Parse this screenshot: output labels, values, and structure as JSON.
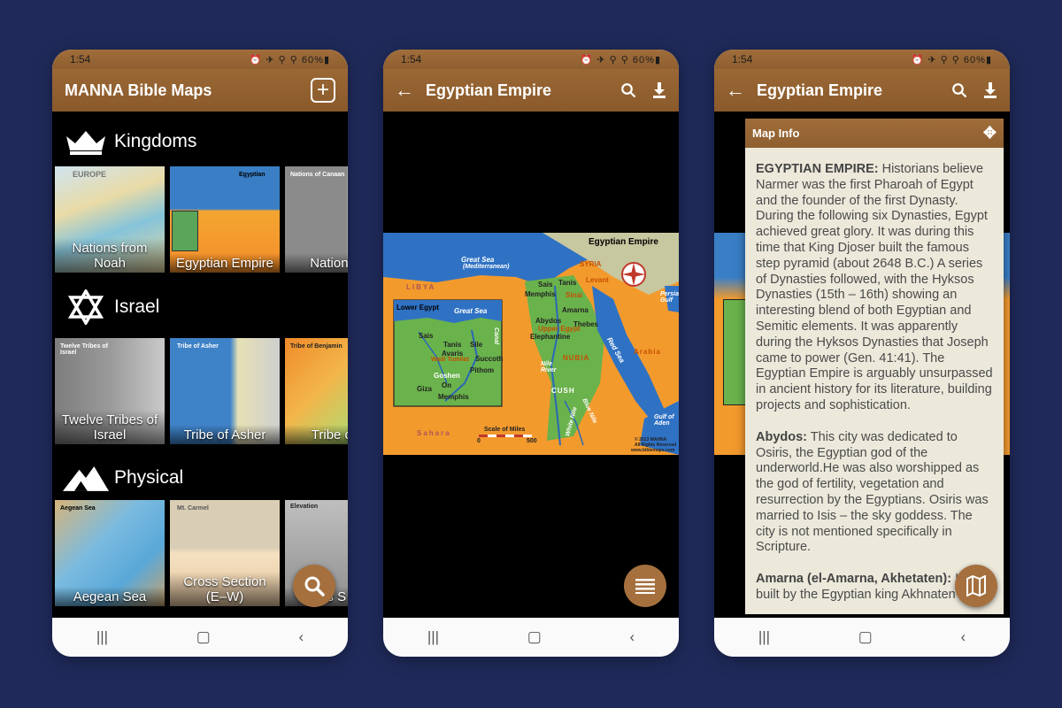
{
  "status": {
    "time": "1:54",
    "battery": "60%"
  },
  "phone1": {
    "app_title": "MANNA Bible Maps",
    "sections": [
      {
        "title": "Kingdoms",
        "icon": "crown-icon",
        "items": [
          {
            "caption": "Nations from Noah",
            "map_label": "EUROPE"
          },
          {
            "caption": "Egyptian Empire",
            "map_label": "Egyptian"
          },
          {
            "caption": "Nations of",
            "map_label": "Nations of Canaan"
          }
        ]
      },
      {
        "title": "Israel",
        "icon": "star-of-david-icon",
        "items": [
          {
            "caption": "Twelve Tribes of Israel",
            "map_label": "Twelve Tribes of Israel"
          },
          {
            "caption": "Tribe of Asher",
            "map_label": "Tribe of Asher"
          },
          {
            "caption": "Tribe of B",
            "map_label": "Tribe of Benjamin"
          }
        ]
      },
      {
        "title": "Physical",
        "icon": "mountains-icon",
        "items": [
          {
            "caption": "Aegean Sea",
            "map_label": "Aegean Sea"
          },
          {
            "caption": "Cross Section (E–W)",
            "map_label": "Mt. Carmel"
          },
          {
            "caption": "ross S (N–",
            "map_label": "Elevation"
          }
        ]
      }
    ]
  },
  "phone2": {
    "title": "Egyptian Empire",
    "map": {
      "title": "Egyptian Empire",
      "labels": {
        "great_sea": "Great Sea",
        "great_sea_sub": "(Mediterranean)",
        "libya": "LIBYA",
        "syria": "SYRIA",
        "levant": "Levant",
        "sais": "Sais",
        "tanis": "Tanis",
        "memphis": "Memphis",
        "sinai": "Sinai",
        "amarna": "Amarna",
        "abydos": "Abydos",
        "thebes": "Thebes",
        "upper_egypt": "Upper Egypt",
        "elephantine": "Elephantine",
        "nubia": "NUBIA",
        "red_sea": "Red Sea",
        "arabia": "Arabia",
        "persian_gulf": "Persian Gulf",
        "nile_river": "Nile River",
        "cush": "CUSH",
        "white_nile": "White Nile",
        "blue_nile": "Blue Nile",
        "gulf_aden": "Gulf of Aden",
        "sahara": "Sahara",
        "scale": "Scale of Miles",
        "scale_0": "0",
        "scale_500": "500",
        "copyright": "© 2013 MANNA",
        "rights": "All Rights Reserved",
        "site": "www.biblemaps.com",
        "inset_title": "Lower Egypt",
        "inset_sea": "Great Sea",
        "inset_sais": "Sais",
        "inset_tanis": "Tanis",
        "inset_sile": "Sile",
        "inset_avaris": "Avaris",
        "inset_wadi": "Wadi Tumilat",
        "inset_succoth": "Succoth",
        "inset_pithom": "Pithom",
        "inset_goshen": "Goshen",
        "inset_on": "On",
        "inset_giza": "Giza",
        "inset_memphis": "Memphis",
        "inset_canal": "Canal"
      }
    }
  },
  "phone3": {
    "title": "Egyptian Empire",
    "panel_title": "Map Info",
    "paragraphs": [
      {
        "heading": "EGYPTIAN EMPIRE:",
        "text": " Historians believe Narmer was the first Pharoah of Egypt and the founder of the first Dynasty. During the following six Dynasties, Egypt achieved great glory. It was during this time that King Djoser built the famous step pyramid (about 2648 B.C.) A series of Dynasties followed, with the Hyksos Dynasties (15th – 16th) showing an interesting blend of both Egyptian and Semitic elements. It was apparently during the Hyksos Dynasties that Joseph came to power (Gen. 41:41). The Egyptian Empire is arguably unsurpassed in ancient history for its literature, building projects and sophistication."
      },
      {
        "heading": "Abydos:",
        "text": " This city was dedicated to Osiris, the Egyptian god of the underworld.He was also worshipped as the god of fertility, vegetation and resurrection by the Egyptians. Osiris was married to Isis – the sky goddess. The city is not mentioned specifically in Scripture."
      },
      {
        "heading": "Amarna (el-Amarna, Akhetaten):",
        "text": " It was built by the Egyptian king Akhnaten in the"
      }
    ]
  },
  "colors": {
    "background": "#1f2a5a",
    "appbar": "#8f5f30",
    "fab": "#a5703e",
    "panel": "#ece9db"
  }
}
